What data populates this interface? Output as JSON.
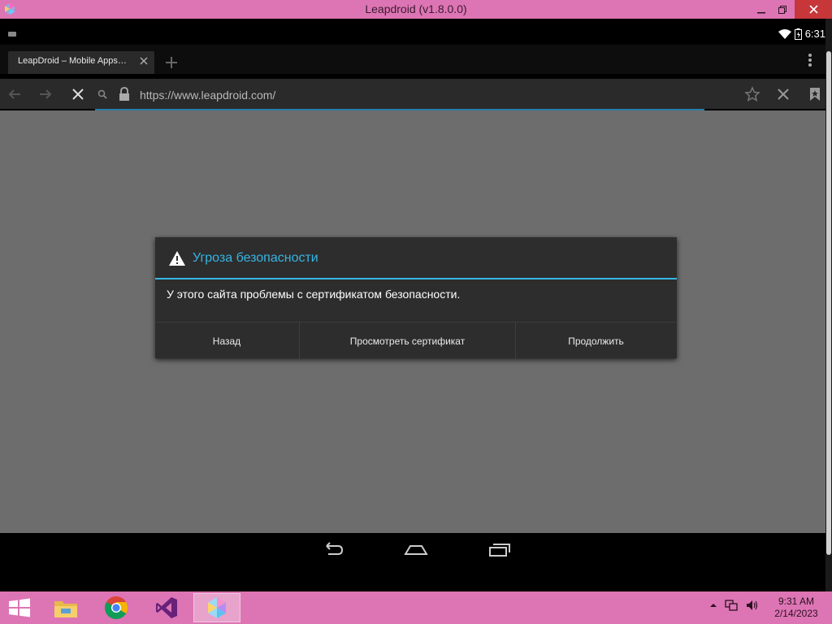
{
  "window": {
    "title": "Leapdroid (v1.8.0.0)",
    "controls": [
      "minimize",
      "restore",
      "close"
    ]
  },
  "android": {
    "status_bar": {
      "time": "6:31"
    },
    "browser": {
      "tab_title": "LeapDroid – Mobile Apps…",
      "url": "https://www.leapdroid.com/",
      "page_loading": true
    },
    "dialog": {
      "icon": "warning-icon",
      "title": "Угроза безопасности",
      "message": "У этого сайта проблемы с сертификатом безопасности.",
      "buttons": {
        "back": "Назад",
        "view_certificate": "Просмотреть сертификат",
        "continue": "Продолжить"
      }
    },
    "nav_bar": [
      "back",
      "home",
      "recent-apps"
    ]
  },
  "taskbar": {
    "apps": [
      {
        "name": "File Explorer",
        "icon": "folder-icon",
        "active": false
      },
      {
        "name": "Google Chrome",
        "icon": "chrome-icon",
        "active": false
      },
      {
        "name": "Visual Studio",
        "icon": "visual-studio-icon",
        "active": false
      },
      {
        "name": "Leapdroid",
        "icon": "leapdroid-icon",
        "active": true
      }
    ],
    "clock": {
      "time": "9:31 AM",
      "date": "2/14/2023"
    }
  },
  "colors": {
    "windows_accent": "#dd75b4",
    "dialog_accent": "#35b5e5",
    "page_background": "#6d6d6d"
  }
}
